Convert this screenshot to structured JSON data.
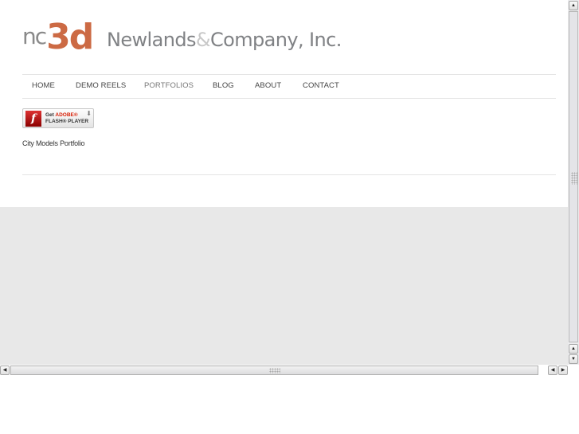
{
  "logo": {
    "mark_nc": "nc",
    "mark_3d": "3d",
    "name_part1": "Newlands",
    "name_amp": "&",
    "name_part2": "Company, Inc."
  },
  "nav": {
    "items": [
      {
        "label": "HOME"
      },
      {
        "label": "DEMO REELS"
      },
      {
        "label": "PORTFOLIOS"
      },
      {
        "label": "BLOG"
      },
      {
        "label": "ABOUT"
      },
      {
        "label": "CONTACT"
      }
    ]
  },
  "flash_badge": {
    "icon": "f",
    "line1_prefix": "Get",
    "line1_brand": "ADOBE®",
    "line2": "FLASH® PLAYER",
    "download_icon": "⬇"
  },
  "content": {
    "caption": "City Models Portfolio"
  },
  "scrollbars": {
    "up_arrow": "▲",
    "down_arrow": "▼",
    "left_arrow": "◀",
    "right_arrow": "▶"
  },
  "colors": {
    "brand_orange": "#cc6a44",
    "brand_gray": "#808285",
    "page_bg_lower": "#e8e8e8"
  }
}
